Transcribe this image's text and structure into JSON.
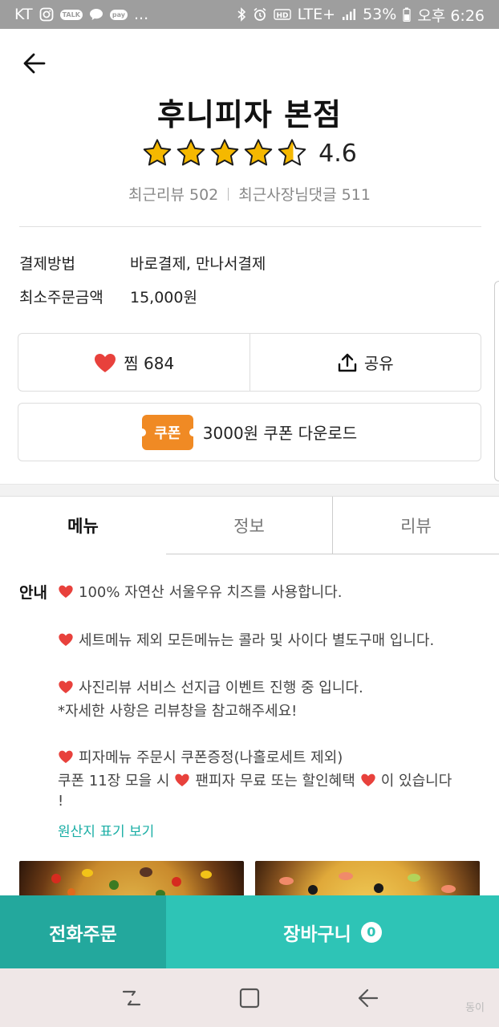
{
  "status_bar": {
    "carrier": "KT",
    "icons_left": [
      "instagram-icon",
      "kakaotalk-icon",
      "messenger-icon",
      "pay-icon",
      "more-icon"
    ],
    "talk_badge": "TALK",
    "pay_badge": "pay",
    "more": "...",
    "network": "LTE+",
    "battery": "53%",
    "time": "오후 6:26"
  },
  "store": {
    "name": "후니피자 본점",
    "rating": "4.6",
    "stars_filled": 4.5,
    "star_color": "#f5b800",
    "recent_reviews": "최근리뷰 502",
    "recent_owner_replies": "최근사장님댓글 511"
  },
  "info": {
    "payment_label": "결제방법",
    "payment_value": "바로결제, 만나서결제",
    "min_order_label": "최소주문금액",
    "min_order_value": "15,000원"
  },
  "actions": {
    "favorite_label": "찜 684",
    "share_label": "공유",
    "heart_color": "#e8413c"
  },
  "coupon": {
    "tag": "쿠폰",
    "label": "3000원 쿠폰 다운로드",
    "tag_color": "#f08a24"
  },
  "tabs": [
    "메뉴",
    "정보",
    "리뷰"
  ],
  "notice": {
    "label": "안내",
    "lines": [
      "100% 자연산 서울우유 치즈를 사용합니다.",
      "세트메뉴 제외 모든메뉴는 콜라 및 사이다 별도구매 입니다.",
      "사진리뷰 서비스 선지급 이벤트 진행 중 입니다.",
      "*자세한 사항은 리뷰창을 참고해주세요!",
      "피자메뉴 주문시 쿠폰증정(나홀로세트 제외)",
      "쿠폰 11장 모을 시",
      "팬피자 무료 또는 할인혜택",
      "이 있습니다",
      "!"
    ],
    "origin_link": "원산지 표기 보기"
  },
  "bottom": {
    "call_label": "전화주문",
    "cart_label": "장바구니",
    "cart_count": "0",
    "accent": "#2ec4b6"
  },
  "watermark": "동이"
}
